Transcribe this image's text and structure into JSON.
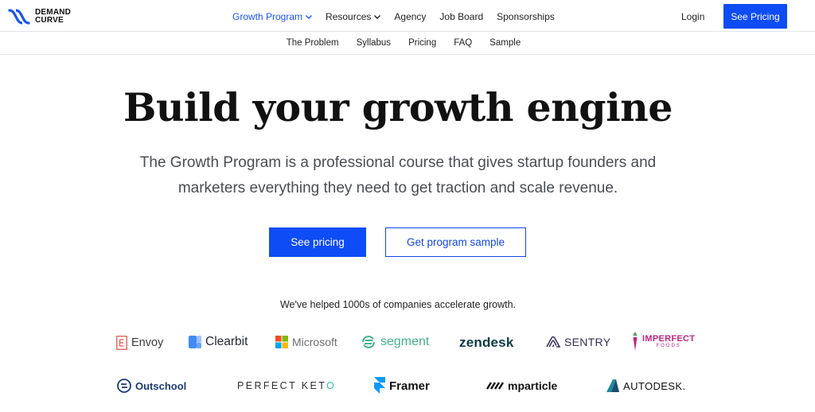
{
  "brand": {
    "line1": "DEMAND",
    "line2": "CURVE"
  },
  "nav": {
    "items": [
      {
        "label": "Growth Program",
        "active": true,
        "dropdown": true
      },
      {
        "label": "Resources",
        "active": false,
        "dropdown": true
      },
      {
        "label": "Agency",
        "active": false,
        "dropdown": false
      },
      {
        "label": "Job Board",
        "active": false,
        "dropdown": false
      },
      {
        "label": "Sponsorships",
        "active": false,
        "dropdown": false
      }
    ],
    "login": "Login",
    "cta": "See Pricing"
  },
  "subnav": {
    "items": [
      "The Problem",
      "Syllabus",
      "Pricing",
      "FAQ",
      "Sample"
    ]
  },
  "hero": {
    "title": "Build your growth engine",
    "subtitle_line1": "The Growth Program is a professional course that gives startup founders and",
    "subtitle_line2": "marketers everything they need to get traction and scale revenue.",
    "primary_button": "See pricing",
    "secondary_button": "Get program sample"
  },
  "trust": {
    "text": "We've helped 1000s of companies accelerate growth.",
    "logos": {
      "envoy": "Envoy",
      "clearbit": "Clearbit",
      "microsoft": "Microsoft",
      "segment": "segment",
      "zendesk": "zendesk",
      "sentry": "SENTRY",
      "imperfect": "IMPERFECT",
      "imperfect_sub": "FOODS",
      "outschool": "Outschool",
      "keto_main": "PERFECT KET",
      "keto_accent": "O",
      "framer": "Framer",
      "mparticle": "mparticle",
      "autodesk": "AUTODESK."
    }
  },
  "colors": {
    "accent": "#0e4cf5",
    "text": "#1f1f1f",
    "muted": "#4a4d52"
  }
}
